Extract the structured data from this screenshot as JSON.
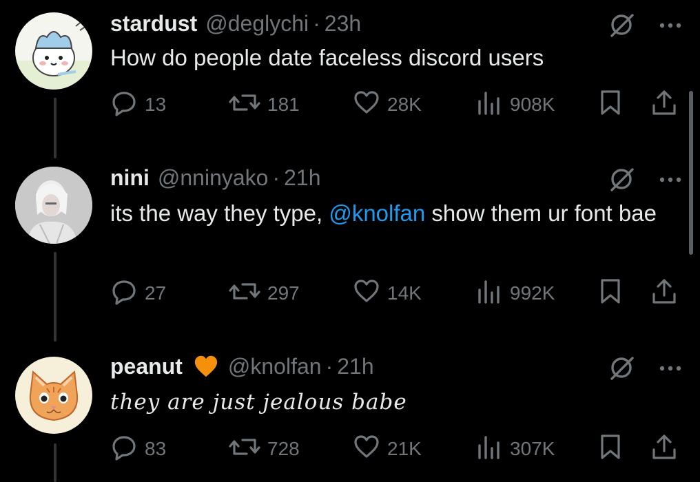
{
  "tweets": [
    {
      "display_name": "stardust",
      "handle": "@deglychi",
      "separator": "·",
      "time": "23h",
      "text_parts": [
        "How do people date faceless discord users"
      ],
      "counts": {
        "replies": "13",
        "reposts": "181",
        "likes": "28K",
        "views": "908K"
      }
    },
    {
      "display_name": "nini",
      "handle": "@nninyako",
      "separator": "·",
      "time": "21h",
      "text_parts": [
        "its the way they type, ",
        "@knolfan",
        " show them ur font bae"
      ],
      "counts": {
        "replies": "27",
        "reposts": "297",
        "likes": "14K",
        "views": "992K"
      }
    },
    {
      "display_name": "peanut",
      "badge_icon": "orange-heart-icon",
      "handle": "@knolfan",
      "separator": "·",
      "time": "21h",
      "text_parts": [
        "they are just jealous babe"
      ],
      "counts": {
        "replies": "83",
        "reposts": "728",
        "likes": "21K",
        "views": "307K"
      }
    }
  ],
  "icons": {
    "reply": "reply-icon",
    "repost": "repost-icon",
    "like": "heart-icon",
    "views": "views-icon",
    "bookmark": "bookmark-icon",
    "share": "share-icon",
    "grok": "grok-icon",
    "more": "more-icon"
  },
  "colors": {
    "background": "#000000",
    "text": "#e7e9ea",
    "muted": "#71767b",
    "link": "#1d9bf0",
    "badge": "#f4900c"
  }
}
